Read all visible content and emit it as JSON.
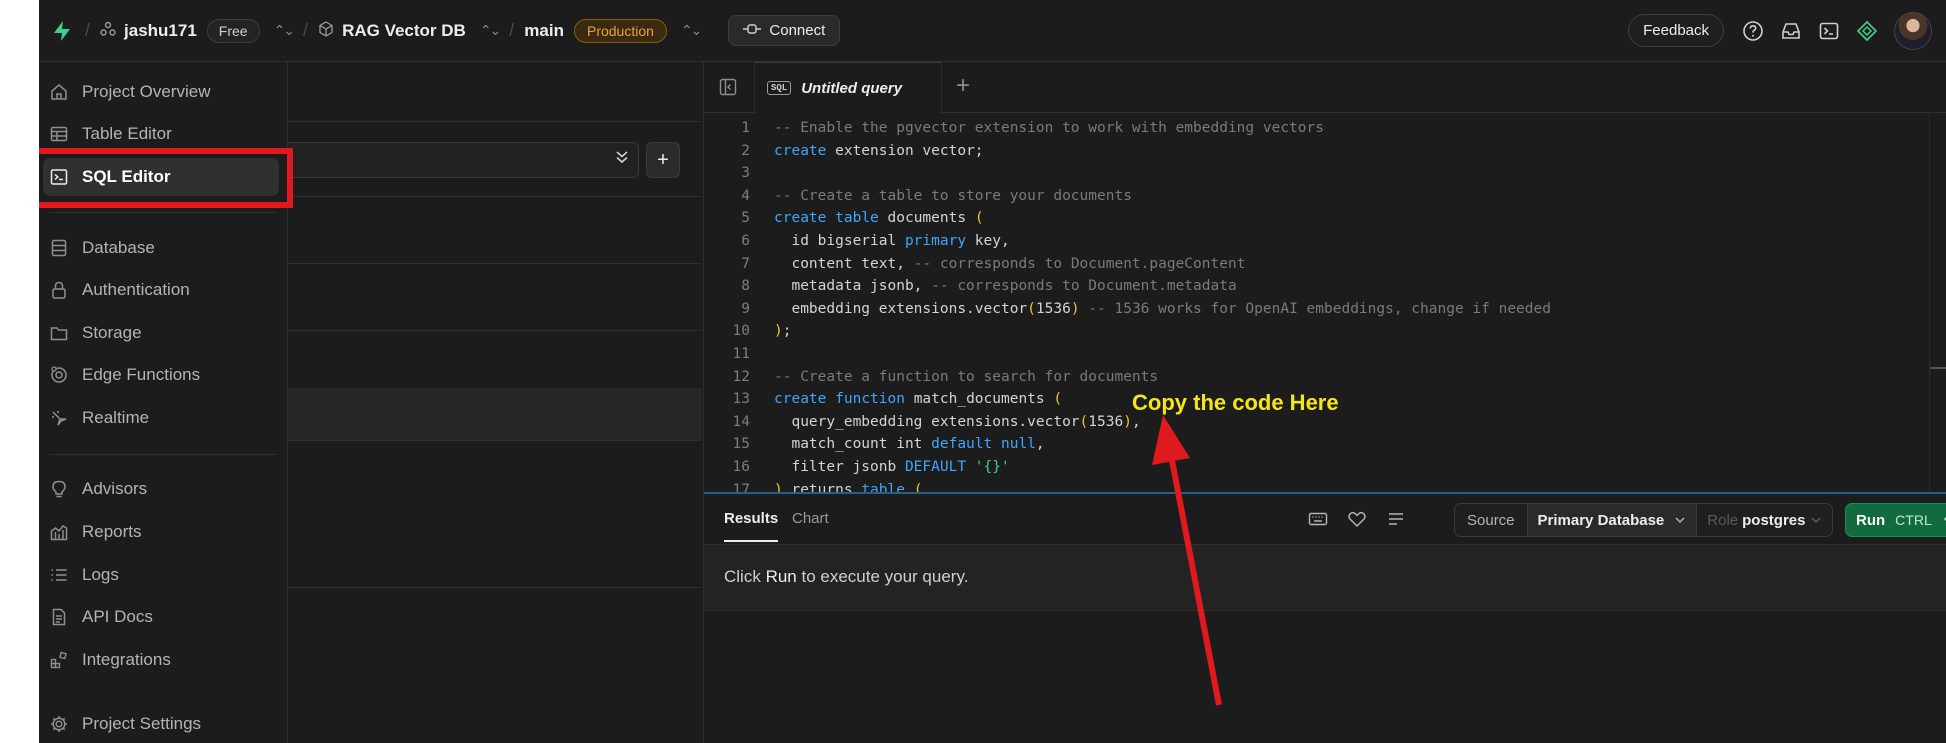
{
  "topbar": {
    "org": "jashu171",
    "plan": "Free",
    "project": "RAG Vector DB",
    "branch": "main",
    "env": "Production",
    "connect": "Connect",
    "feedback": "Feedback"
  },
  "sidebar": {
    "items": [
      {
        "label": "Project Overview",
        "icon": "home-icon"
      },
      {
        "label": "Table Editor",
        "icon": "table-icon"
      },
      {
        "label": "SQL Editor",
        "icon": "terminal-icon",
        "active": true
      },
      {
        "label": "Database",
        "icon": "database-icon"
      },
      {
        "label": "Authentication",
        "icon": "lock-icon"
      },
      {
        "label": "Storage",
        "icon": "storage-icon"
      },
      {
        "label": "Edge Functions",
        "icon": "edge-functions-icon"
      },
      {
        "label": "Realtime",
        "icon": "realtime-icon"
      },
      {
        "label": "Advisors",
        "icon": "lightbulb-icon"
      },
      {
        "label": "Reports",
        "icon": "reports-icon"
      },
      {
        "label": "Logs",
        "icon": "list-icon"
      },
      {
        "label": "API Docs",
        "icon": "file-icon"
      },
      {
        "label": "Integrations",
        "icon": "integrations-icon"
      },
      {
        "label": "Project Settings",
        "icon": "gear-icon"
      }
    ]
  },
  "editor": {
    "tab_badge": "SQL",
    "tab_label": "Untitled query",
    "add_tab": "+",
    "lines": [
      {
        "n": "1",
        "t": [
          [
            "cm",
            "-- Enable the pgvector extension to work with embedding vectors"
          ]
        ]
      },
      {
        "n": "2",
        "t": [
          [
            "kw",
            "create"
          ],
          [
            "",
            " extension vector;"
          ]
        ]
      },
      {
        "n": "3",
        "t": []
      },
      {
        "n": "4",
        "t": [
          [
            "cm",
            "-- Create a table to store your documents"
          ]
        ]
      },
      {
        "n": "5",
        "t": [
          [
            "kw",
            "create"
          ],
          [
            "",
            " "
          ],
          [
            "kw",
            "table"
          ],
          [
            "",
            " documents "
          ],
          [
            "br",
            "("
          ]
        ]
      },
      {
        "n": "6",
        "t": [
          [
            "",
            "  id bigserial "
          ],
          [
            "kw",
            "primary"
          ],
          [
            "",
            " key,"
          ]
        ]
      },
      {
        "n": "7",
        "t": [
          [
            "",
            "  content text, "
          ],
          [
            "cm",
            "-- corresponds to Document.pageContent"
          ]
        ]
      },
      {
        "n": "8",
        "t": [
          [
            "",
            "  metadata jsonb, "
          ],
          [
            "cm",
            "-- corresponds to Document.metadata"
          ]
        ]
      },
      {
        "n": "9",
        "t": [
          [
            "",
            "  embedding extensions.vector"
          ],
          [
            "br",
            "("
          ],
          [
            "",
            "1536"
          ],
          [
            "br",
            ")"
          ],
          [
            "",
            " "
          ],
          [
            "cm",
            "-- 1536 works for OpenAI embeddings, change if needed"
          ]
        ]
      },
      {
        "n": "10",
        "t": [
          [
            "br",
            ")"
          ],
          [
            "",
            ";"
          ]
        ]
      },
      {
        "n": "11",
        "t": []
      },
      {
        "n": "12",
        "t": [
          [
            "cm",
            "-- Create a function to search for documents"
          ]
        ]
      },
      {
        "n": "13",
        "t": [
          [
            "kw",
            "create"
          ],
          [
            "",
            " "
          ],
          [
            "kw",
            "function"
          ],
          [
            "",
            " match_documents "
          ],
          [
            "br",
            "("
          ]
        ]
      },
      {
        "n": "14",
        "t": [
          [
            "",
            "  query_embedding extensions.vector"
          ],
          [
            "br",
            "("
          ],
          [
            "",
            "1536"
          ],
          [
            "br",
            ")"
          ],
          [
            "",
            ","
          ]
        ]
      },
      {
        "n": "15",
        "t": [
          [
            "",
            "  match_count int "
          ],
          [
            "kw",
            "default"
          ],
          [
            "",
            " "
          ],
          [
            "kw",
            "null"
          ],
          [
            "",
            ","
          ]
        ]
      },
      {
        "n": "16",
        "t": [
          [
            "",
            "  filter jsonb "
          ],
          [
            "kw",
            "DEFAULT"
          ],
          [
            "",
            " "
          ],
          [
            "st",
            "'{}'"
          ]
        ]
      },
      {
        "n": "17",
        "t": [
          [
            "br",
            ")"
          ],
          [
            "",
            " returns "
          ],
          [
            "kw",
            "table"
          ],
          [
            "",
            " "
          ],
          [
            "br",
            "("
          ]
        ]
      }
    ]
  },
  "results": {
    "tabs": [
      "Results",
      "Chart"
    ],
    "source_label": "Source",
    "source_value": "Primary Database",
    "role_label": "Role",
    "role_value": "postgres",
    "run_label": "Run",
    "run_shortcut": "CTRL",
    "msg_pre": "Click ",
    "msg_run": "Run",
    "msg_post": " to execute your query."
  },
  "annotation": {
    "text": "Copy the code Here"
  },
  "colors": {
    "accent_green": "#3ecf8e",
    "highlight_red": "#e0191f",
    "annotation_yellow": "#f5e617"
  }
}
